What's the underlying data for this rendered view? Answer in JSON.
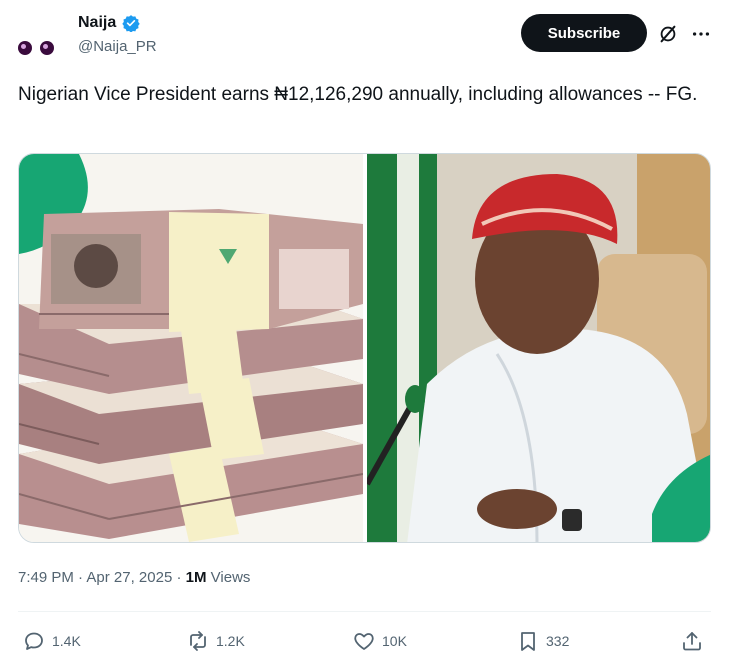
{
  "author": {
    "display_name": "Naija",
    "handle": "@Naija_PR",
    "verified_icon": "verified-badge-icon",
    "avatar_colors": {
      "face": "#3a0b3d",
      "highlight": "#d9a6e0"
    }
  },
  "header": {
    "subscribe_label": "Subscribe",
    "grok_icon": "grok-icon",
    "more_icon": "more-options-icon"
  },
  "tweet": {
    "text": "Nigerian Vice President earns ₦12,126,290 annually, including allowances -- FG."
  },
  "meta": {
    "time": "7:49 PM",
    "date": "Apr 27, 2025",
    "views_count": "1M",
    "views_label": "Views"
  },
  "actions": {
    "replies": "1.4K",
    "reposts": "1.2K",
    "likes": "10K",
    "bookmarks": "332"
  },
  "colors": {
    "accent_green": "#17a673",
    "verified_blue": "#1d9bf0",
    "text_primary": "#0f1419",
    "text_secondary": "#536471"
  }
}
